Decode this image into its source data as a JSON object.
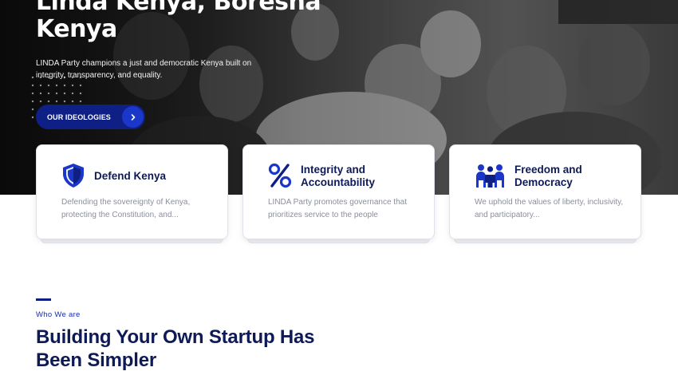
{
  "hero": {
    "title": "Linda Kenya, Boresha Kenya",
    "subtitle": "LINDA Party champions a just and democratic Kenya built on integrity, transparency, and equality.",
    "cta_label": "OUR IDEOLOGIES",
    "cta_icon": "chevron-right-icon",
    "image": "crowd-photo"
  },
  "cards": [
    {
      "icon": "shield-icon",
      "title": "Defend Kenya",
      "description": "Defending the sovereignty of Kenya, protecting the Constitution, and..."
    },
    {
      "icon": "percent-icon",
      "title": "Integrity and Accountability",
      "description": "LINDA Party promotes governance that prioritizes service to the people"
    },
    {
      "icon": "people-icon",
      "title": "Freedom and Democracy",
      "description": "We uphold the values of liberty, inclusivity, and participatory..."
    }
  ],
  "about": {
    "kicker": "Who We are",
    "heading": "Building Your Own Startup Has Been Simpler"
  },
  "colors": {
    "brand_navy": "#0e1f86",
    "brand_blue": "#1a37c9",
    "heading_text": "#0e1a55",
    "muted_text": "#8a8f9c"
  }
}
